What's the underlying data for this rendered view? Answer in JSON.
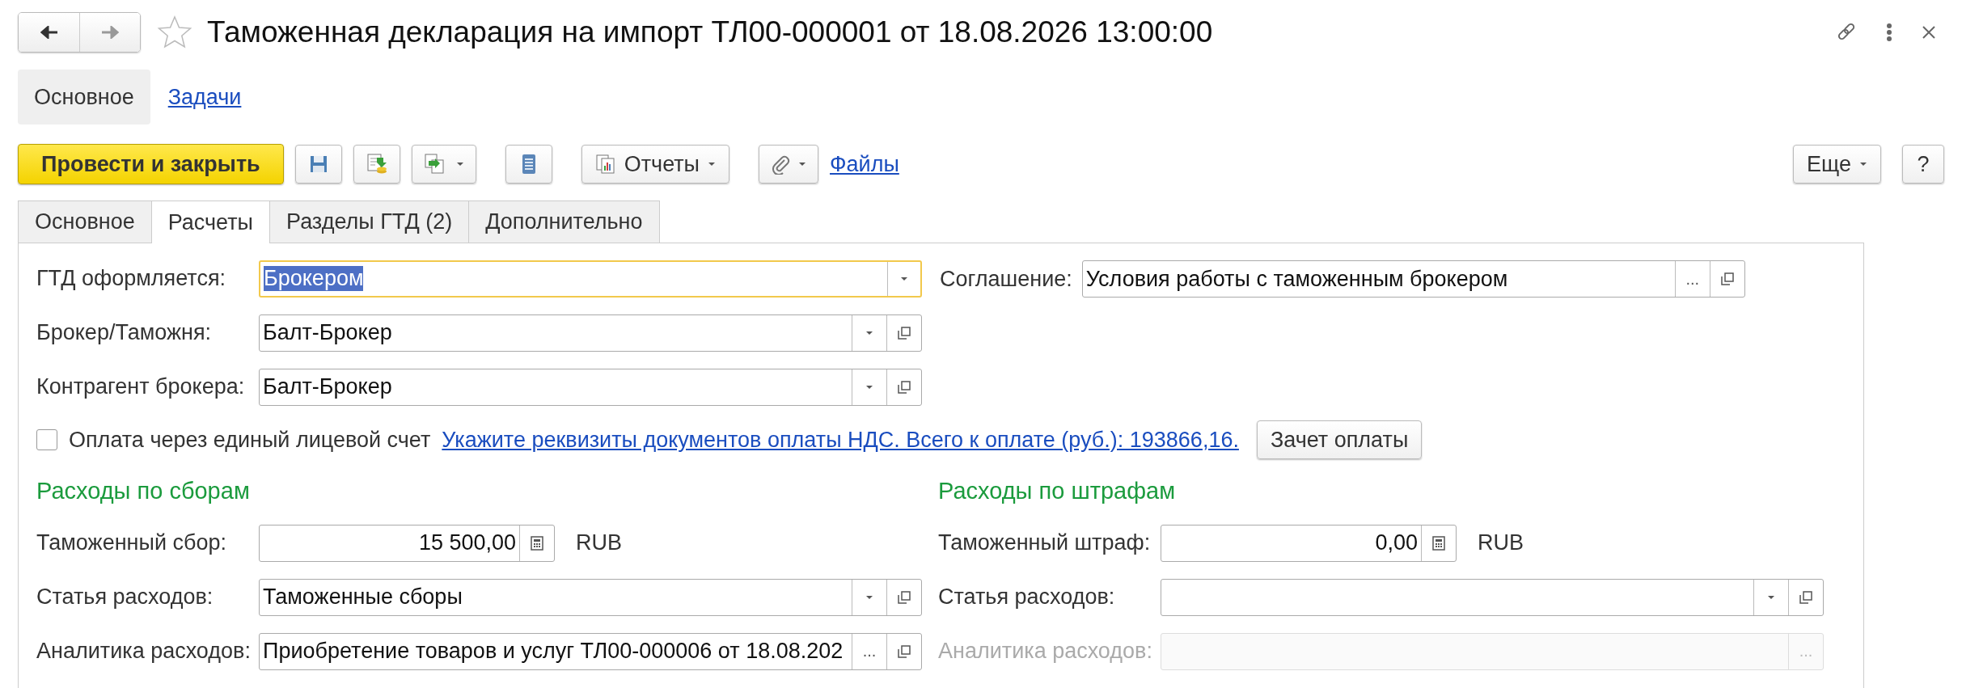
{
  "title": "Таможенная декларация на импорт ТЛ00-000001 от 18.08.2026 13:00:00",
  "favorite": false,
  "sections": [
    {
      "label": "Основное",
      "selected": true
    },
    {
      "label": "Задачи",
      "selected": false
    }
  ],
  "toolbar": {
    "primary": "Провести и закрыть",
    "reports": "Отчеты",
    "files": "Файлы",
    "more": "Еще",
    "help": "?"
  },
  "tabs": [
    {
      "label": "Основное",
      "selected": false
    },
    {
      "label": "Расчеты",
      "selected": true
    },
    {
      "label": "Разделы ГТД (2)",
      "selected": false
    },
    {
      "label": "Дополнительно",
      "selected": false
    }
  ],
  "header_fields": [
    {
      "kind": "dropdown",
      "label": "ГТД оформляется:",
      "value": "Брокером",
      "focused": true
    },
    {
      "kind": "dropdown_open",
      "label": "Брокер/Таможня:",
      "value": "Балт-Брокер"
    },
    {
      "kind": "dropdown_open",
      "label": "Контрагент брокера:",
      "value": "Балт-Брокер"
    }
  ],
  "agreement": {
    "kind": "select_open",
    "label": "Соглашение:",
    "value": "Условия работы с таможенным брокером",
    "select_button": "..."
  },
  "payment": {
    "checkbox": {
      "label": "Оплата через единый лицевой счет",
      "checked": false
    },
    "link": "Укажите реквизиты документов оплаты НДС. Всего к оплате (руб.): 193866,16.",
    "button": "Зачет оплаты"
  },
  "groups": [
    {
      "title": "Расходы по сборам",
      "fields": [
        {
          "kind": "amount",
          "label": "Таможенный сбор:",
          "value": "15 500,00",
          "currency": "RUB"
        },
        {
          "kind": "dropdown_open",
          "label": "Статья расходов:",
          "value": "Таможенные сборы"
        },
        {
          "kind": "select_open",
          "label": "Аналитика расходов:",
          "value": "Приобретение товаров и услуг ТЛ00-000006 от 18.08.202",
          "select_button": "..."
        }
      ]
    },
    {
      "title": "Расходы по штрафам",
      "fields": [
        {
          "kind": "amount",
          "label": "Таможенный штраф:",
          "value": "0,00",
          "currency": "RUB"
        },
        {
          "kind": "dropdown_open",
          "label": "Статья расходов:"
        },
        {
          "kind": "select",
          "label": "Аналитика расходов:",
          "disabled": true,
          "select_button": "..."
        }
      ]
    }
  ]
}
